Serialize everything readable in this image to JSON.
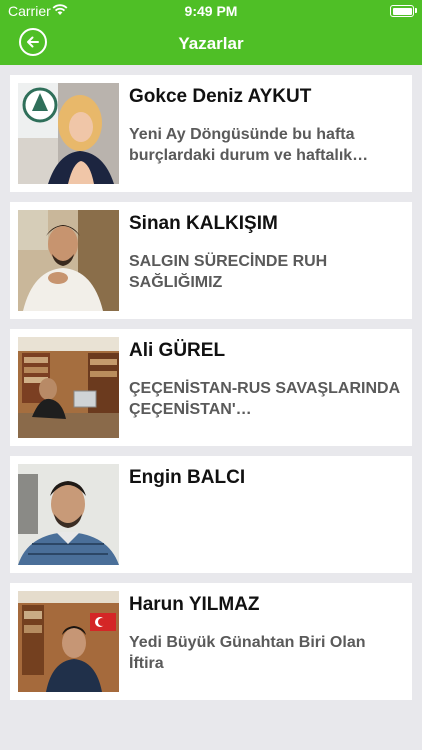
{
  "status": {
    "carrier": "Carrier",
    "time": "9:49 PM"
  },
  "header": {
    "title": "Yazarlar",
    "accent": "#4fbf26"
  },
  "authors": [
    {
      "name": "Gokce Deniz AYKUT",
      "article": "Yeni Ay Döngüsünde bu hafta burçlardaki durum ve haftalık…"
    },
    {
      "name": "Sinan KALKIŞIM",
      "article": "SALGIN SÜRECİNDE RUH SAĞLIĞIMIZ"
    },
    {
      "name": "Ali GÜREL",
      "article": "ÇEÇENİSTAN-RUS SAVAŞLARINDA ÇEÇENİSTAN'…"
    },
    {
      "name": "Engin BALCI",
      "article": ""
    },
    {
      "name": "Harun YILMAZ",
      "article": "Yedi Büyük Günahtan Biri Olan İftira"
    }
  ]
}
